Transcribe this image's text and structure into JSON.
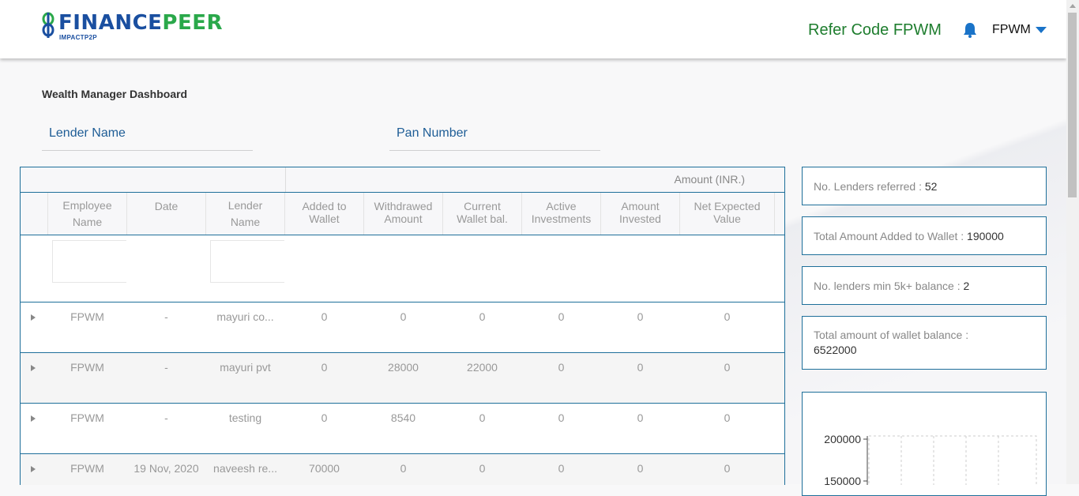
{
  "header": {
    "logo_main_part1": "FINANCE",
    "logo_main_part2": "PEER",
    "logo_sub": "IMPACTP2P",
    "refer_code": "Refer Code FPWM",
    "user": "FPWM"
  },
  "page_title": "Wealth Manager Dashboard",
  "filters": {
    "lender_name_placeholder": "Lender Name",
    "pan_number_placeholder": "Pan Number"
  },
  "table": {
    "group_header": "Amount (INR.)",
    "columns": [
      "Employee\nName",
      "Date",
      "Lender\nName",
      "Added to\nWallet",
      "Withdrawed\nAmount",
      "Current\nWallet bal.",
      "Active\nInvestments",
      "Amount\nInvested",
      "Net Expected\nValue"
    ],
    "rows": [
      [
        "FPWM",
        "-",
        "mayuri co...",
        "0",
        "0",
        "0",
        "0",
        "0",
        "0"
      ],
      [
        "FPWM",
        "-",
        "mayuri pvt",
        "0",
        "28000",
        "22000",
        "0",
        "0",
        "0"
      ],
      [
        "FPWM",
        "-",
        "testing",
        "0",
        "8540",
        "0",
        "0",
        "0",
        "0"
      ],
      [
        "FPWM",
        "19 Nov, 2020",
        "naveesh re...",
        "70000",
        "0",
        "0",
        "0",
        "0",
        "0"
      ]
    ]
  },
  "stats": [
    {
      "label": "No. Lenders referred : ",
      "value": "52"
    },
    {
      "label": "Total Amount Added to Wallet : ",
      "value": "190000"
    },
    {
      "label": "No. lenders min 5k+ balance : ",
      "value": "2"
    },
    {
      "label": "Total amount of wallet balance : ",
      "value": "6522000"
    }
  ],
  "chart_data": {
    "type": "bar",
    "categories": [],
    "values": [],
    "title": "",
    "xlabel": "",
    "ylabel": "",
    "yticks": [
      "200000",
      "150000"
    ]
  },
  "colors": {
    "brand_blue": "#1a4fa0",
    "brand_green": "#2aa84a",
    "refer_green": "#1e7d2e",
    "border_blue": "#1e6f9a"
  },
  "icons": {
    "bell": "bell-icon",
    "dropdown": "chevron-down-icon",
    "expand": "caret-right-icon"
  }
}
